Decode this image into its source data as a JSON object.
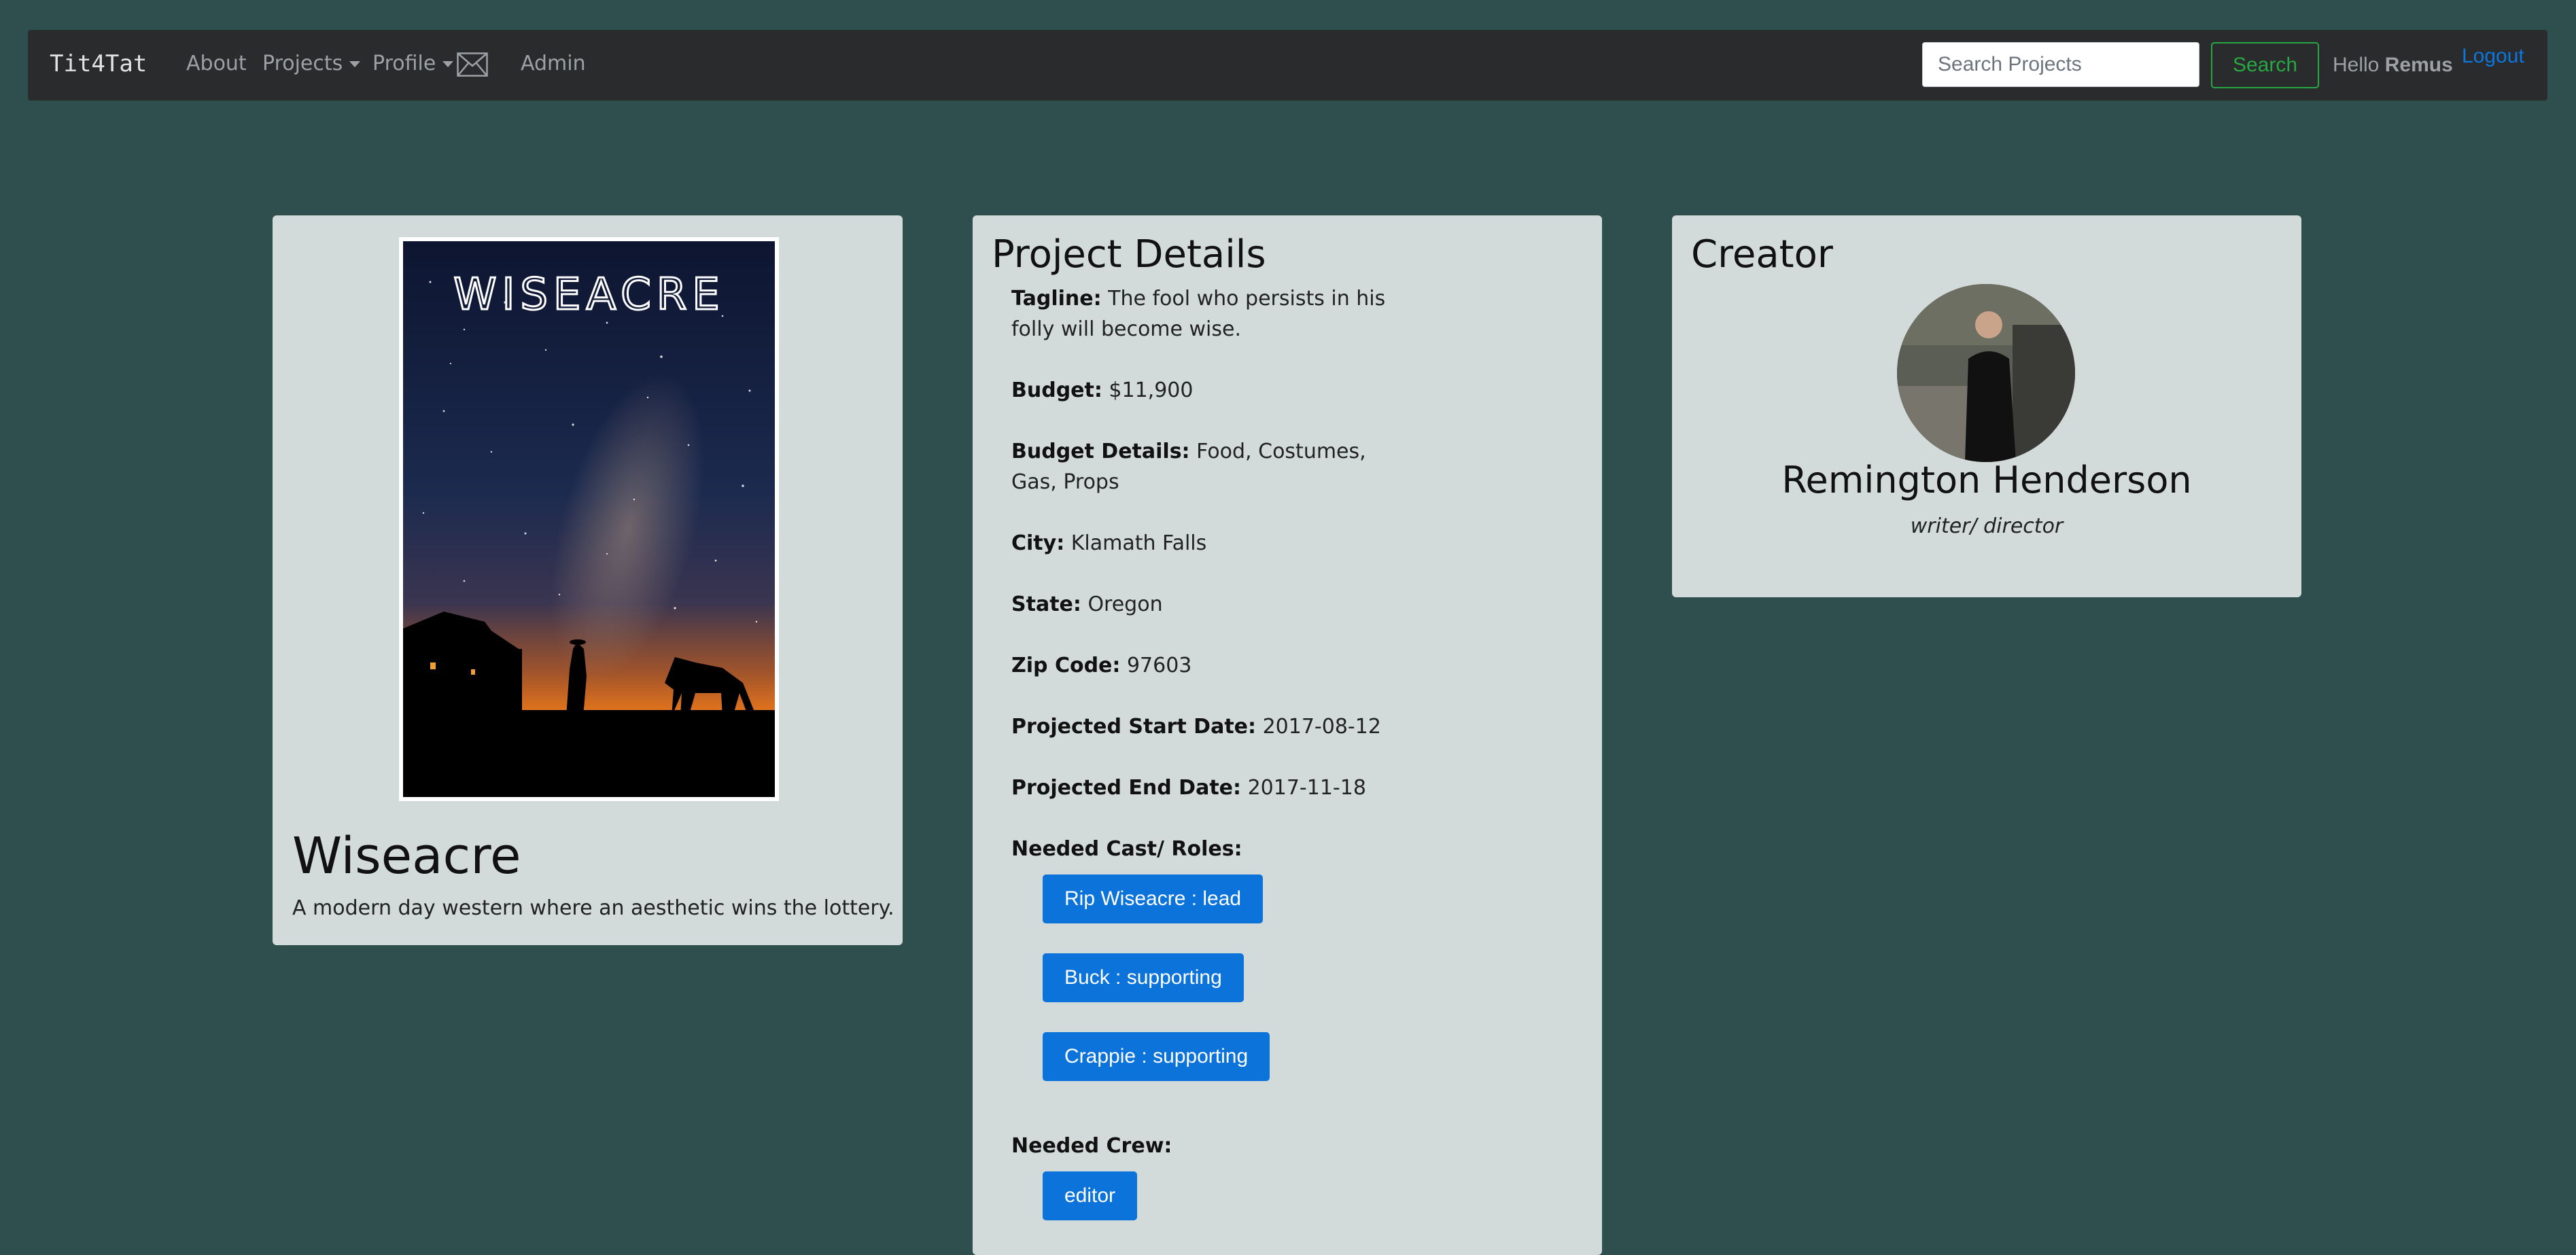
{
  "navbar": {
    "brand": "Tit4Tat",
    "about": "About",
    "projects": "Projects",
    "profile": "Profile",
    "admin": "Admin",
    "search_placeholder": "Search Projects",
    "search_button": "Search",
    "hello_prefix": "Hello",
    "username": "Remus",
    "logout": "Logout"
  },
  "project": {
    "poster_text": "WISEACRE",
    "title": "Wiseacre",
    "description": "A modern day western where an aesthetic wins the lottery."
  },
  "details": {
    "heading": "Project Details",
    "tagline_label": "Tagline:",
    "tagline": "The fool who persists in his folly will become wise.",
    "budget_label": "Budget:",
    "budget": "$11,900",
    "budget_details_label": "Budget Details:",
    "budget_details": "Food, Costumes, Gas, Props",
    "city_label": "City:",
    "city": "Klamath Falls",
    "state_label": "State:",
    "state": "Oregon",
    "zip_label": "Zip Code:",
    "zip": "97603",
    "start_label": "Projected Start Date:",
    "start": "2017-08-12",
    "end_label": "Projected End Date:",
    "end": "2017-11-18",
    "cast_label": "Needed Cast/ Roles:",
    "cast": [
      "Rip Wiseacre : lead",
      "Buck : supporting",
      "Crappie : supporting"
    ],
    "crew_label": "Needed Crew:",
    "crew": [
      "editor"
    ]
  },
  "creator": {
    "heading": "Creator",
    "name": "Remington Henderson",
    "role": "writer/ director"
  },
  "colors": {
    "background": "#2f4f4f",
    "navbar": "#2a2b2d",
    "card": "#d3dada",
    "primary": "#0b73d9",
    "success": "#28a745",
    "link": "#0b77e0"
  }
}
